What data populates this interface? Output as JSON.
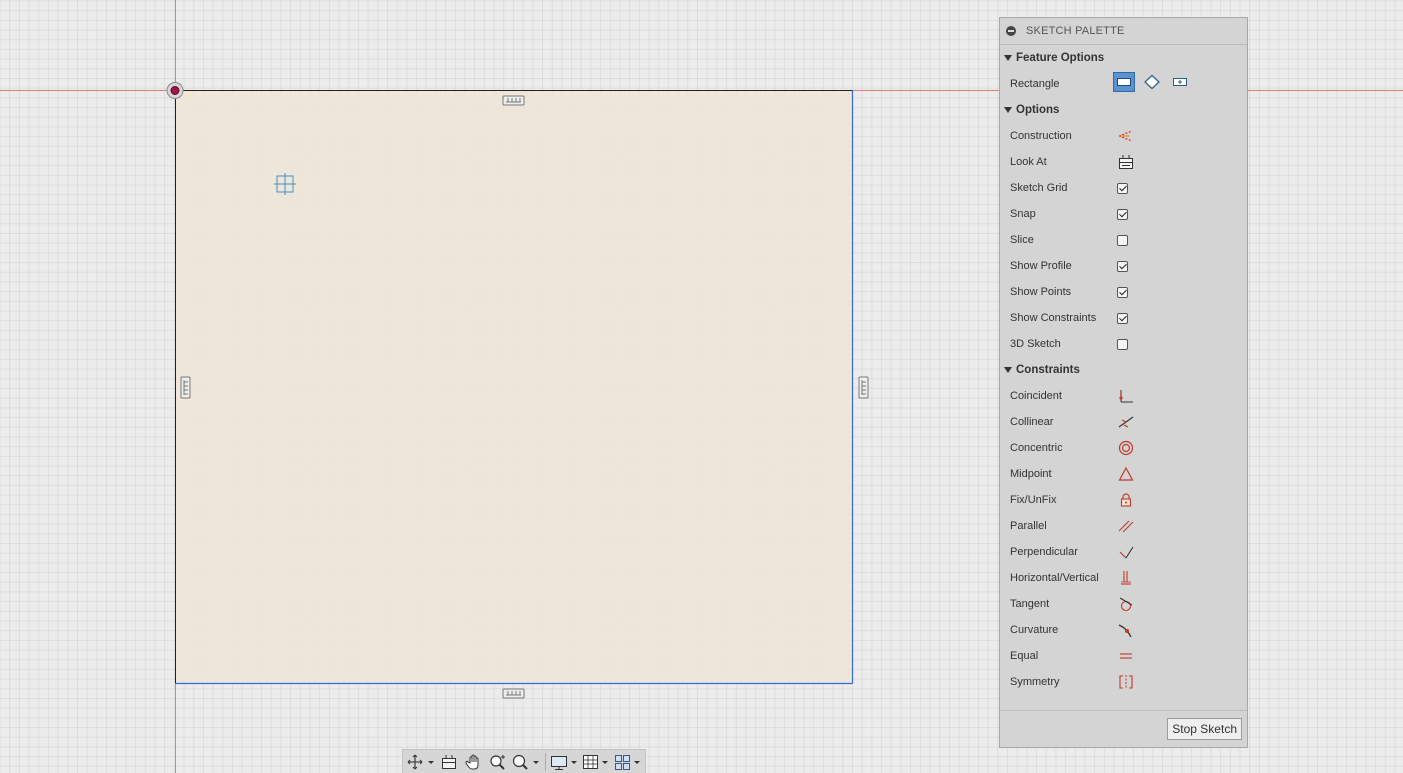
{
  "palette": {
    "title": "SKETCH PALETTE",
    "sections": {
      "feature_options": "Feature Options",
      "options": "Options",
      "constraints": "Constraints"
    },
    "feature_options": {
      "rectangle_label": "Rectangle",
      "rectangle_modes": [
        "2-point-rectangle-icon",
        "3-point-rectangle-icon",
        "center-rectangle-icon"
      ],
      "active_mode": "2-point-rectangle-icon"
    },
    "options": [
      {
        "label": "Construction",
        "type": "icon",
        "icon": "construction-icon"
      },
      {
        "label": "Look At",
        "type": "icon",
        "icon": "look-at-icon"
      },
      {
        "label": "Sketch Grid",
        "type": "checkbox",
        "checked": true
      },
      {
        "label": "Snap",
        "type": "checkbox",
        "checked": true
      },
      {
        "label": "Slice",
        "type": "checkbox",
        "checked": false
      },
      {
        "label": "Show Profile",
        "type": "checkbox",
        "checked": true
      },
      {
        "label": "Show Points",
        "type": "checkbox",
        "checked": true
      },
      {
        "label": "Show Constraints",
        "type": "checkbox",
        "checked": true
      },
      {
        "label": "3D Sketch",
        "type": "checkbox",
        "checked": false
      }
    ],
    "constraints": [
      {
        "label": "Coincident",
        "icon": "coincident-icon"
      },
      {
        "label": "Collinear",
        "icon": "collinear-icon"
      },
      {
        "label": "Concentric",
        "icon": "concentric-icon"
      },
      {
        "label": "Midpoint",
        "icon": "midpoint-icon"
      },
      {
        "label": "Fix/UnFix",
        "icon": "lock-icon"
      },
      {
        "label": "Parallel",
        "icon": "parallel-icon"
      },
      {
        "label": "Perpendicular",
        "icon": "perpendicular-icon"
      },
      {
        "label": "Horizontal/Vertical",
        "icon": "horizontal-vertical-icon"
      },
      {
        "label": "Tangent",
        "icon": "tangent-icon"
      },
      {
        "label": "Curvature",
        "icon": "curvature-icon"
      },
      {
        "label": "Equal",
        "icon": "equal-icon"
      },
      {
        "label": "Symmetry",
        "icon": "symmetry-icon"
      }
    ],
    "stop_label": "Stop Sketch"
  },
  "navbar": {
    "tools": [
      "orbit-icon",
      "look-at-icon",
      "pan-icon",
      "zoom-icon",
      "fit-icon",
      "display-settings-icon",
      "grid-snap-icon",
      "viewports-icon"
    ]
  },
  "colors": {
    "profile_fill": "#efe5d6",
    "x_axis": "#e05a5a",
    "y_axis": "#4cc44c",
    "selected_edge": "#2e6bd8",
    "active_tool": "#5a93cf",
    "constraint_icon": "#c0392b"
  }
}
